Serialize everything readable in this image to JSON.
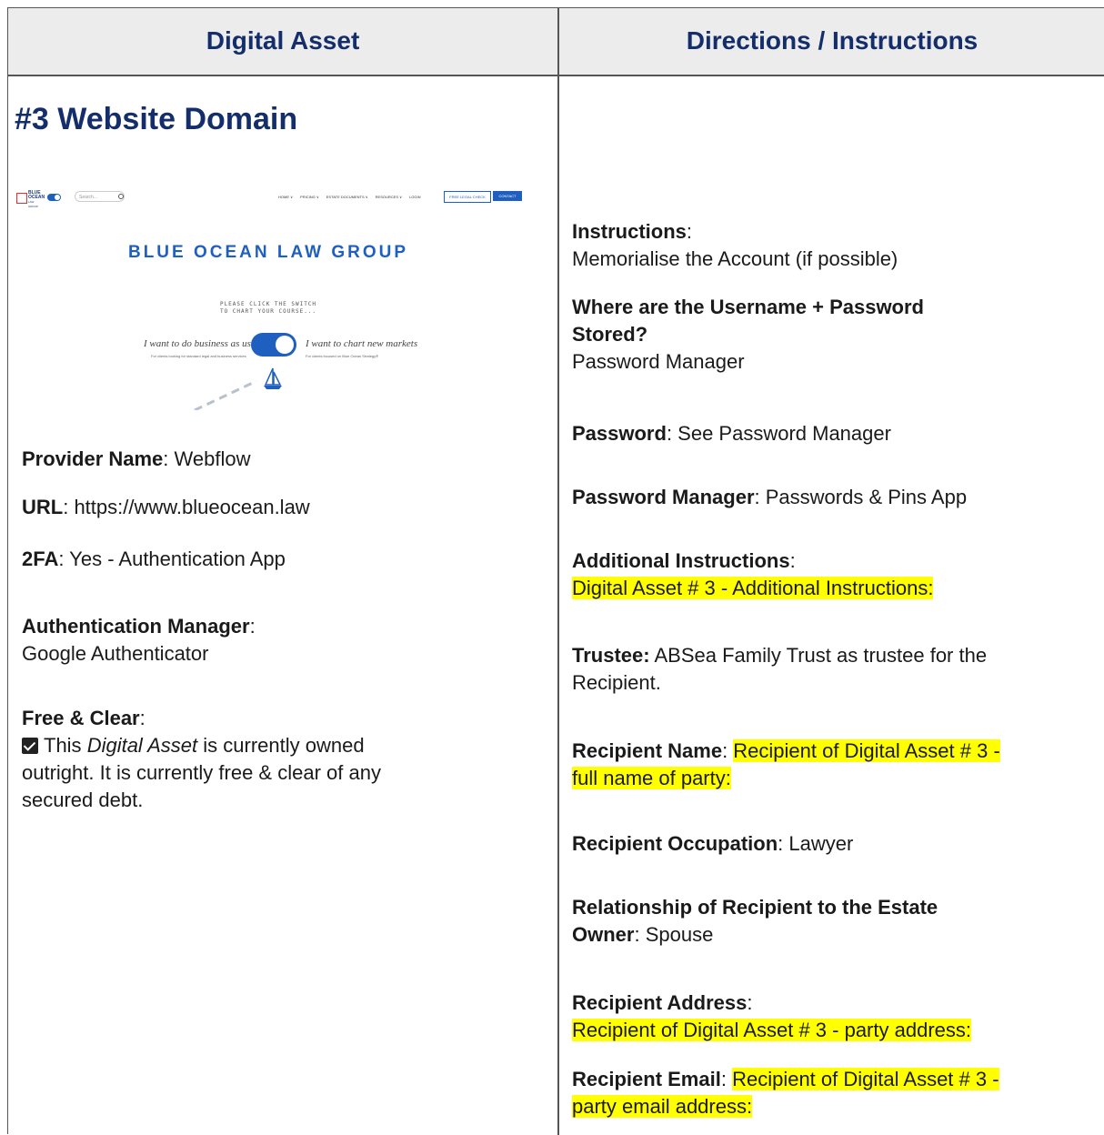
{
  "headers": {
    "left": "Digital Asset",
    "right": "Directions / Instructions"
  },
  "asset": {
    "title": "#3 Website Domain",
    "provider_label": "Provider Name",
    "provider_value": ": Webflow",
    "url_label": "URL",
    "url_value": ": https://www.blueocean.law",
    "twofa_label": "2FA",
    "twofa_value": ": Yes - Authentication App",
    "auth_label": "Authentication Manager",
    "auth_colon": ":",
    "auth_value": "Google Authenticator",
    "free_label": "Free & Clear",
    "free_colon": ":",
    "free_text_1": "This ",
    "free_text_em": "Digital Asset",
    "free_text_2": " is currently owned",
    "free_text_3": "outright. It is currently free & clear of any",
    "free_text_4": "secured debt."
  },
  "preview": {
    "logo_text": "BLUE OCEAN LAW GROUP",
    "search_placeholder": "Search...",
    "nav": [
      "HOME ∨",
      "PRICING ∨",
      "ESTATE DOCUMENTS ∨",
      "RESOURCES ∨",
      "LOGIN"
    ],
    "free_check": "FREE LEGAL CHECK",
    "contact": "CONTACT",
    "headline": "BLUE OCEAN LAW GROUP",
    "prompt_1": "PLEASE CLICK THE SWITCH",
    "prompt_2": "TO CHART YOUR COURSE...",
    "left_option": "I want to do business as usual",
    "left_sub": "For clients looking for standard legal and business services",
    "right_option": "I want to chart new markets",
    "right_sub": "For clients focused on Blue Ocean Strategy®"
  },
  "directions": {
    "instructions_label": "Instructions",
    "instructions_colon": ":",
    "instructions_value": "Memorialise the Account (if possible)",
    "stored_label_1": "Where are the Username + Password",
    "stored_label_2": "Stored?",
    "stored_value": "Password Manager",
    "password_label": "Password",
    "password_value": ": See Password Manager",
    "pm_label": "Password Manager",
    "pm_value": ": Passwords & Pins App",
    "additional_label": "Additional Instructions",
    "additional_colon": ":",
    "additional_value": "Digital Asset # 3 - Additional Instructions:",
    "trustee_label": "Trustee:",
    "trustee_value_1": " ABSea Family Trust as trustee for the",
    "trustee_value_2": "Recipient.",
    "recipient_name_label": "Recipient Name",
    "recipient_name_colon": ": ",
    "recipient_name_value_1": "Recipient of Digital Asset # 3 -",
    "recipient_name_value_2": "full name of party:",
    "occupation_label": "Recipient Occupation",
    "occupation_value": ": Lawyer",
    "relationship_label_1": "Relationship of Recipient to the Estate",
    "relationship_label_2": "Owner",
    "relationship_value": ": Spouse",
    "address_label": "Recipient Address",
    "address_colon": ":",
    "address_value": "Recipient of Digital Asset # 3 - party address:",
    "email_label": "Recipient Email",
    "email_colon": ": ",
    "email_value_1": "Recipient of Digital Asset # 3 -",
    "email_value_2": "party email address:"
  },
  "colors": {
    "heading": "#142e6b",
    "highlight": "#ffff00",
    "brand_blue": "#1f5fbf"
  }
}
